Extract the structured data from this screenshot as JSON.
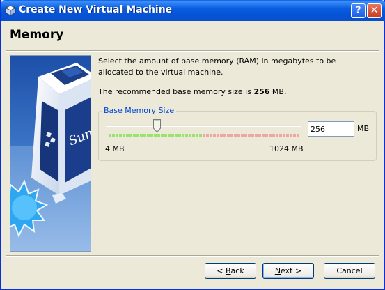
{
  "window": {
    "title": "Create New Virtual Machine",
    "help_button": "?",
    "close_button": "✕"
  },
  "page": {
    "heading": "Memory",
    "description": "Select the amount of base memory (RAM) in megabytes to be allocated to the virtual machine.",
    "recommended_prefix": "The recommended base memory size is ",
    "recommended_value": "256",
    "recommended_suffix": " MB."
  },
  "memory_group": {
    "legend_pre": "Base ",
    "legend_mnemonic": "M",
    "legend_post": "emory Size",
    "value": "256",
    "unit": "MB",
    "min_label": "4 MB",
    "max_label": "1024 MB",
    "slider_fraction": 0.25,
    "scale_segments": {
      "green": 27,
      "red": 28
    },
    "colors": {
      "green": "#99e26e",
      "red": "#f0a6a0"
    }
  },
  "buttons": {
    "back_pre": "< ",
    "back_mnemonic": "B",
    "back_post": "ack",
    "next_mnemonic": "N",
    "next_post": "ext >",
    "cancel": "Cancel"
  },
  "icons": {
    "app_icon": "virtualbox-cube-icon",
    "wizard_image": "virtualbox-sun-logo"
  }
}
